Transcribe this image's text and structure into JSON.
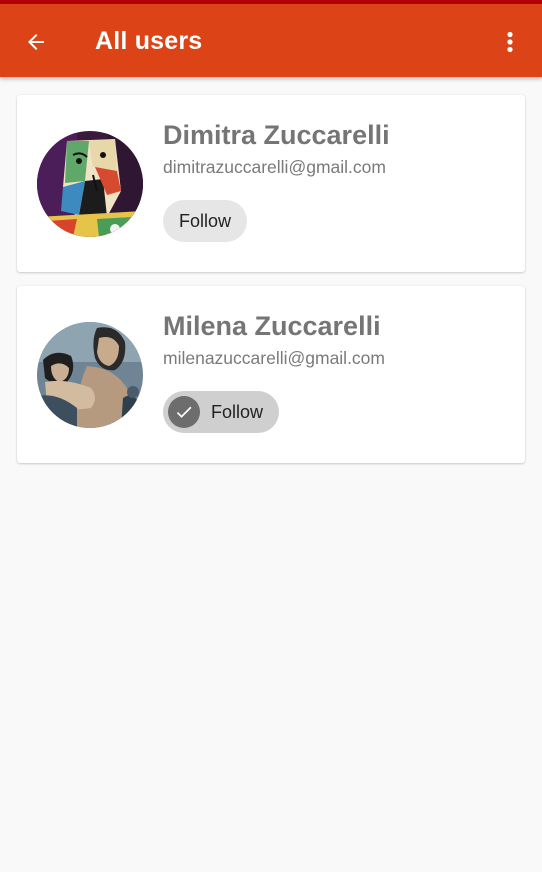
{
  "app_bar": {
    "title": "All users",
    "back_icon": "arrow-back-icon",
    "overflow_icon": "more-vert-icon",
    "color": "#dc4316",
    "status_color": "#b3000b"
  },
  "users": [
    {
      "name": "Dimitra Zuccarelli",
      "email": "dimitrazuccarelli@gmail.com",
      "follow_label": "Follow",
      "following": false,
      "avatar_icon": "cubist-portrait-avatar"
    },
    {
      "name": "Milena Zuccarelli",
      "email": "milenazuccarelli@gmail.com",
      "follow_label": "Follow",
      "following": true,
      "check_icon": "check-icon",
      "avatar_icon": "blue-period-portrait-avatar"
    }
  ]
}
